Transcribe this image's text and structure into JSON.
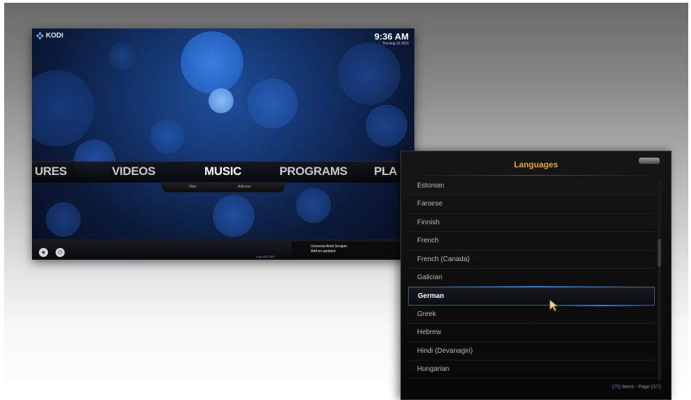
{
  "kodi": {
    "logo_text": "KODI",
    "clock_time": "9:36 AM",
    "clock_date": "Thu Aug 13 2015",
    "menu": [
      "URES",
      "VIDEOS",
      "MUSIC",
      "PROGRAMS",
      "PLA"
    ],
    "active_menu": "MUSIC",
    "submenu": [
      "Files",
      "Add-ons"
    ],
    "bottom_buttons": [
      "favourites",
      "power"
    ],
    "addon_notice": {
      "title": "Universal Artist Scraper",
      "subtitle": "Add-on updated"
    },
    "weather_text": "Low 40°F 19°F"
  },
  "dialog": {
    "title": "Languages",
    "close_label": "close",
    "items": [
      "Estonian",
      "Faroese",
      "Finnish",
      "French",
      "French (Canada)",
      "Galician",
      "German",
      "Greek",
      "Hebrew",
      "Hindi (Devanagiri)",
      "Hungarian"
    ],
    "selected_item": "German",
    "footer": {
      "count": "75",
      "items_text": " Items - Page ",
      "page": "3/7"
    }
  },
  "colors": {
    "accent": "#e8a520",
    "highlight": "#2e7de0"
  }
}
